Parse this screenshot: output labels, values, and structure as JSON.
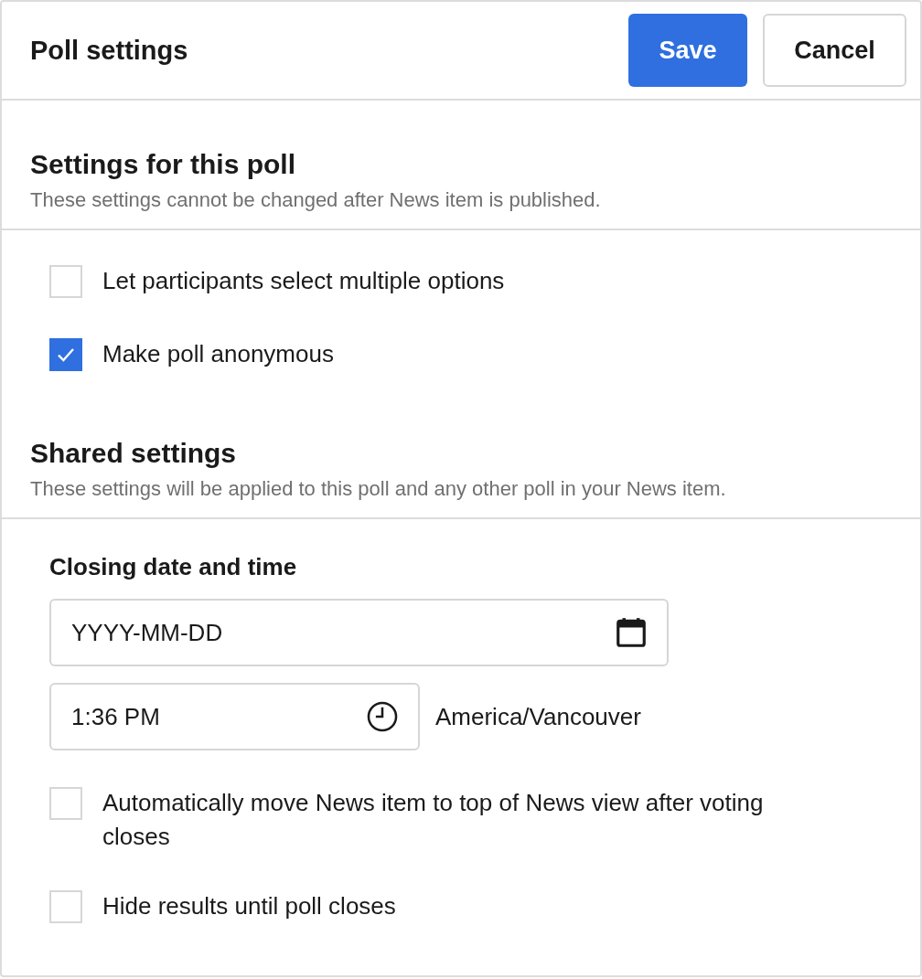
{
  "header": {
    "title": "Poll settings",
    "buttons": [
      {
        "label": "Save",
        "kind": "primary"
      },
      {
        "label": "Cancel",
        "kind": "secondary"
      }
    ]
  },
  "sections": [
    {
      "title": "Settings for this poll",
      "description": "These settings cannot be changed after News item is published.",
      "items": [
        {
          "kind": "checkbox",
          "label": "Let participants select multiple options",
          "checked": false
        },
        {
          "kind": "checkbox",
          "label": "Make poll anonymous",
          "checked": true
        }
      ]
    },
    {
      "title": "Shared settings",
      "description": "These settings will be applied to this poll and any other poll in your News item.",
      "items": [
        {
          "kind": "datetime",
          "label": "Closing date and time",
          "date": {
            "placeholder": "YYYY-MM-DD"
          },
          "time": {
            "value": "1:36 PM"
          },
          "timezone": "America/Vancouver"
        },
        {
          "kind": "checkbox",
          "label": "Automatically move News item to top of News view after voting closes",
          "checked": false
        },
        {
          "kind": "checkbox",
          "label": "Hide results until poll closes",
          "checked": false
        }
      ]
    }
  ]
}
